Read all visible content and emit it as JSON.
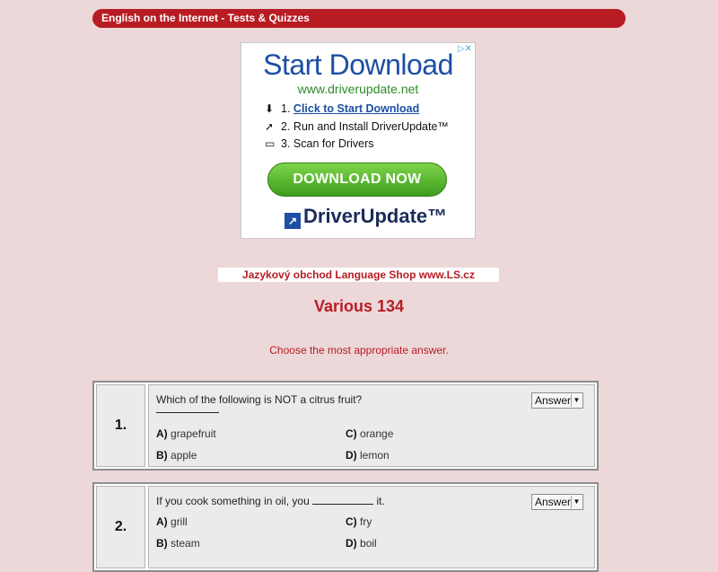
{
  "header": {
    "title": "English on the Internet - Tests & Quizzes"
  },
  "ad": {
    "title": "Start Download",
    "url": "www.driverupdate.net",
    "steps": [
      {
        "num": "1.",
        "text": "Click to Start Download",
        "icon": "download-icon"
      },
      {
        "num": "2.",
        "text": "Run and Install DriverUpdate™",
        "icon": "cursor-icon"
      },
      {
        "num": "3.",
        "text": "Scan for Drivers",
        "icon": "monitor-icon"
      }
    ],
    "button_label": "DOWNLOAD NOW",
    "brand": "DriverUpdate™",
    "choice_icon": "adchoices-icon"
  },
  "shop_link": "Jazykový obchod Language Shop www.LS.cz",
  "page_title": "Various 134",
  "instruction": "Choose the most appropriate answer.",
  "questions": [
    {
      "number": "1.",
      "text_before": "Which of the following is NOT a citrus fruit?",
      "text_after": "",
      "answer_label": "Answer",
      "options": [
        {
          "letter": "A)",
          "text": "grapefruit"
        },
        {
          "letter": "B)",
          "text": "apple"
        },
        {
          "letter": "C)",
          "text": "orange"
        },
        {
          "letter": "D)",
          "text": "lemon"
        }
      ]
    },
    {
      "number": "2.",
      "text_before": "If you cook something in oil, you",
      "text_after": "it.",
      "answer_label": "Answer",
      "options": [
        {
          "letter": "A)",
          "text": "grill"
        },
        {
          "letter": "B)",
          "text": "steam"
        },
        {
          "letter": "C)",
          "text": "fry"
        },
        {
          "letter": "D)",
          "text": "boil"
        }
      ]
    }
  ],
  "colors": {
    "accent": "#b71c23",
    "background": "#ecd7d9",
    "ad_blue": "#1d4fa3",
    "ad_green": "#3d9e1d"
  }
}
